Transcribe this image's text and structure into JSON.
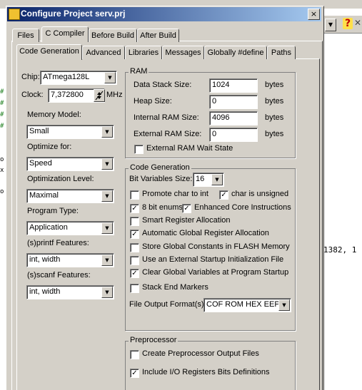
{
  "window": {
    "title": "Configure Project serv.prj",
    "close_glyph": "×"
  },
  "background": {
    "code_fragment": "1382, 1",
    "left_gutter": [
      "#",
      "#",
      "#",
      "#",
      "#",
      "",
      "",
      "o",
      "x",
      "o",
      "",
      "",
      "",
      "",
      "",
      "",
      "",
      "",
      "",
      "",
      "",
      "",
      "",
      "",
      "",
      "",
      "",
      "",
      "",
      "",
      "",
      "",
      "",
      "",
      "",
      "",
      "",
      "",
      "",
      "",
      "",
      "",
      "",
      "",
      "",
      ""
    ]
  },
  "outer_tabs": [
    "Files",
    "C Compiler",
    "Before Build",
    "After Build"
  ],
  "inner_tabs": [
    "Code Generation",
    "Advanced",
    "Libraries",
    "Messages",
    "Globally #define",
    "Paths"
  ],
  "left": {
    "chip_label": "Chip:",
    "chip_value": "ATmega128L",
    "clock_label": "Clock:",
    "clock_value": "7,372800",
    "clock_unit": "MHz",
    "memory_model_label": "Memory Model:",
    "memory_model_value": "Small",
    "optimize_label": "Optimize for:",
    "optimize_value": "Speed",
    "opt_level_label": "Optimization Level:",
    "opt_level_value": "Maximal",
    "program_type_label": "Program Type:",
    "program_type_value": "Application",
    "printf_label": "(s)printf Features:",
    "printf_value": "int, width",
    "scanf_label": "(s)scanf Features:",
    "scanf_value": "int, width"
  },
  "ram": {
    "title": "RAM",
    "data_stack_label": "Data Stack Size:",
    "data_stack_value": "1024",
    "heap_label": "Heap Size:",
    "heap_value": "0",
    "internal_label": "Internal RAM Size:",
    "internal_value": "4096",
    "external_label": "External RAM Size:",
    "external_value": "0",
    "unit": "bytes",
    "wait_state_label": "External RAM Wait State",
    "wait_state_checked": false
  },
  "codegen": {
    "title": "Code Generation",
    "bitvars_label": "Bit Variables Size:",
    "bitvars_value": "16",
    "promote_label": "Promote char to int",
    "promote_checked": false,
    "unsigned_label": "char is unsigned",
    "unsigned_checked": true,
    "enums_label": "8 bit enums",
    "enums_checked": true,
    "enhanced_label": "Enhanced Core Instructions",
    "enhanced_checked": true,
    "smart_label": "Smart Register Allocation",
    "smart_checked": false,
    "auto_label": "Automatic Global Register Allocation",
    "auto_checked": true,
    "flash_label": "Store Global Constants in FLASH Memory",
    "flash_checked": false,
    "startup_label": "Use an External Startup Initialization File",
    "startup_checked": false,
    "clear_label": "Clear Global Variables at Program Startup",
    "clear_checked": true,
    "stackend_label": "Stack End Markers",
    "stackend_checked": false,
    "output_label": "File Output Format(s):",
    "output_value": "COF ROM HEX EEP"
  },
  "preprocessor": {
    "title": "Preprocessor",
    "create_label": "Create Preprocessor Output Files",
    "create_checked": false,
    "include_label": "Include I/O Registers Bits Definitions",
    "include_checked": true
  }
}
